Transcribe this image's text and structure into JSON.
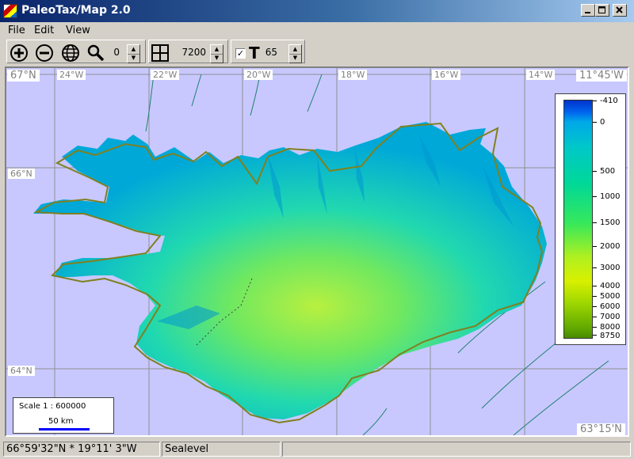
{
  "window": {
    "title": "PaleoTax/Map 2.0"
  },
  "menu": {
    "items": [
      {
        "label": "File"
      },
      {
        "label": "Edit"
      },
      {
        "label": "View"
      }
    ]
  },
  "toolbar": {
    "zoom_value": "0",
    "grid_value": "7200",
    "text_checked": "✓",
    "text_label": "T",
    "text_value": "65"
  },
  "map": {
    "corner_top_left": "67°N",
    "corner_top_right": "11°45'W",
    "corner_bottom_right": "63°15'N",
    "top_lon_labels": [
      "24°W",
      "22°W",
      "20°W",
      "18°W",
      "16°W",
      "14°W"
    ],
    "lat_labels": [
      "66°N",
      "64°N"
    ],
    "legend_labels": [
      "-410",
      "0",
      "500",
      "1000",
      "1500",
      "2000",
      "3000",
      "4000",
      "5000",
      "6000",
      "7000",
      "8000",
      "8750"
    ],
    "scale_text": "Scale 1 : 600000",
    "scale_km": "50 km",
    "colors": {
      "sea": "#c8c8ff",
      "grid": "#909090",
      "coast_line": "#808020",
      "land_low": "#00a8d8",
      "land_high": "#b8f040"
    }
  },
  "status": {
    "coords": "66°59'32\"N *  19°11' 3\"W",
    "mode": "Sealevel",
    "extra": ""
  }
}
